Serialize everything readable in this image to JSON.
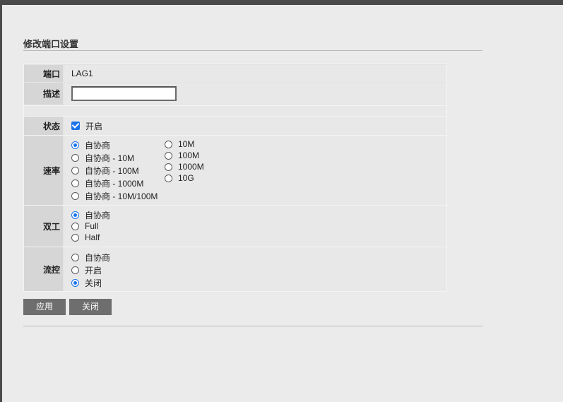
{
  "page": {
    "title": "修改端口设置"
  },
  "form": {
    "port": {
      "label": "端口",
      "value": "LAG1"
    },
    "description": {
      "label": "描述",
      "value": ""
    },
    "state": {
      "label": "状态",
      "option": "开启",
      "checked": true
    },
    "speed": {
      "label": "速率",
      "auto_options": [
        "自协商",
        "自协商 - 10M",
        "自协商 - 100M",
        "自协商 - 1000M",
        "自协商 - 10M/100M"
      ],
      "fixed_options": [
        "10M",
        "100M",
        "1000M",
        "10G"
      ],
      "selected": "自协商"
    },
    "duplex": {
      "label": "双工",
      "options": [
        "自协商",
        "Full",
        "Half"
      ],
      "selected": "自协商"
    },
    "flow_control": {
      "label": "流控",
      "options": [
        "自协商",
        "开启",
        "关闭"
      ],
      "selected": "关闭"
    }
  },
  "buttons": {
    "apply": "应用",
    "close": "关闭"
  },
  "colors": {
    "accent": "#1a73e8",
    "button_bg": "#6e6e6e",
    "label_bg": "#d6d6d6"
  }
}
